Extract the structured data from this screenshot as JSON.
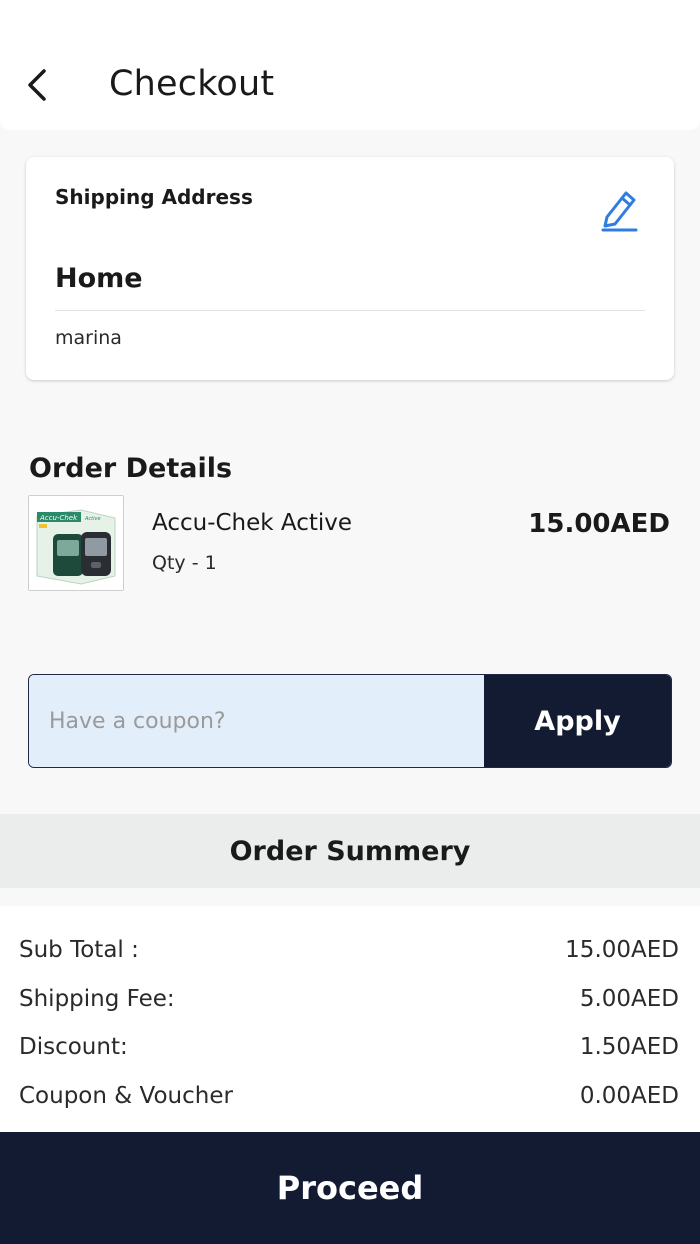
{
  "header": {
    "title": "Checkout",
    "back_icon": "chevron-left-icon"
  },
  "shipping": {
    "section_label": "Shipping Address",
    "edit_icon": "pencil-icon",
    "accent_color": "#2f7de1",
    "address_name": "Home",
    "address_line": "marina"
  },
  "order_details": {
    "title": "Order Details",
    "items": [
      {
        "name": "Accu-Chek Active",
        "qty_label": "Qty - ",
        "qty": "1",
        "price": "15.00AED",
        "thumb_brand": "Accu-Chek",
        "thumb_sub": "Active"
      }
    ]
  },
  "coupon": {
    "placeholder": "Have a coupon?",
    "value": "",
    "apply_label": "Apply"
  },
  "summary": {
    "title": "Order Summery",
    "rows": [
      {
        "label": "Sub Total :",
        "value": "15.00AED"
      },
      {
        "label": "Shipping Fee:",
        "value": "5.00AED"
      },
      {
        "label": "Discount:",
        "value": "1.50AED"
      },
      {
        "label": "Coupon & Voucher",
        "value": "0.00AED"
      }
    ]
  },
  "proceed_label": "Proceed",
  "colors": {
    "primary_dark": "#131b33",
    "coupon_bg": "#e3eefb",
    "accent": "#2f7de1"
  }
}
